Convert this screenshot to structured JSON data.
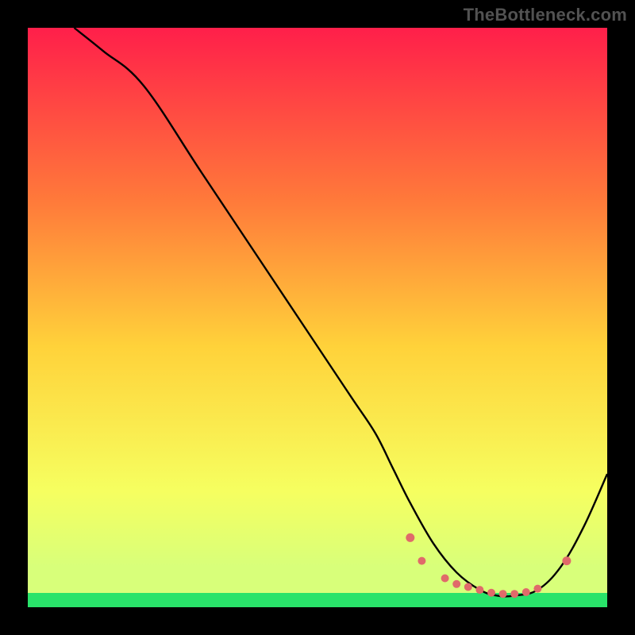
{
  "watermark": "TheBottleneck.com",
  "gradient": {
    "top": "#ff1f4a",
    "upper_mid": "#ff7a3a",
    "mid": "#ffd23a",
    "lower_mid": "#f6ff60",
    "low": "#d8ff7a",
    "bottom_band": "#29e36a"
  },
  "chart_data": {
    "type": "line",
    "title": "",
    "xlabel": "",
    "ylabel": "",
    "xlim": [
      0,
      100
    ],
    "ylim": [
      0,
      100
    ],
    "series": [
      {
        "name": "bottleneck-curve",
        "x": [
          8,
          13,
          20,
          30,
          40,
          50,
          56,
          60,
          63,
          66,
          70,
          74,
          78,
          81,
          84,
          88,
          92,
          96,
          100
        ],
        "y": [
          100,
          96,
          90,
          75,
          60,
          45,
          36,
          30,
          24,
          18,
          11,
          6,
          3,
          2,
          2,
          3,
          7,
          14,
          23
        ]
      }
    ],
    "scatter_highlight": {
      "name": "highlight-dots",
      "color": "#e06a6a",
      "points": [
        {
          "x": 66,
          "y": 12
        },
        {
          "x": 68,
          "y": 8
        },
        {
          "x": 72,
          "y": 5
        },
        {
          "x": 74,
          "y": 4
        },
        {
          "x": 76,
          "y": 3.5
        },
        {
          "x": 78,
          "y": 3
        },
        {
          "x": 80,
          "y": 2.5
        },
        {
          "x": 82,
          "y": 2.3
        },
        {
          "x": 84,
          "y": 2.3
        },
        {
          "x": 86,
          "y": 2.6
        },
        {
          "x": 88,
          "y": 3.2
        },
        {
          "x": 93,
          "y": 8
        }
      ]
    }
  }
}
